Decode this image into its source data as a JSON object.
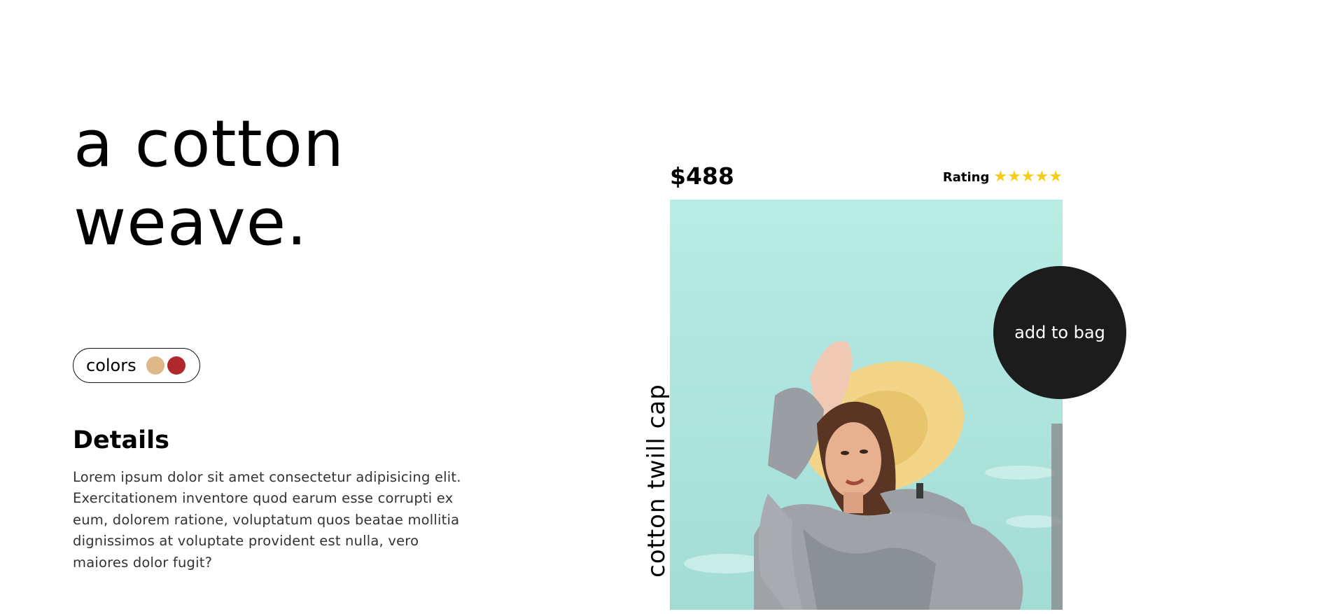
{
  "hero": {
    "headline_line1": "a cotton",
    "headline_line2": "weave."
  },
  "colors": {
    "label": "colors",
    "swatches": [
      "#dfb88a",
      "#b0282b"
    ]
  },
  "details": {
    "title": "Details",
    "text": "Lorem ipsum dolor sit amet consectetur adipisicing elit. Exercitationem inventore quod earum esse corrupti ex eum, dolorem ratione, voluptatum quos beatae mollitia dignissimos at voluptate provident est nulla, vero maiores dolor fugit?"
  },
  "product": {
    "price": "$488",
    "rating_label": "Rating",
    "rating_stars": 5,
    "name": "cotton twill cap",
    "cta_label": "add to bag"
  },
  "theme": {
    "accent_dark": "#1c1c1c",
    "star_color": "#f5cc16",
    "photo_sky": "#b6ebe4"
  }
}
